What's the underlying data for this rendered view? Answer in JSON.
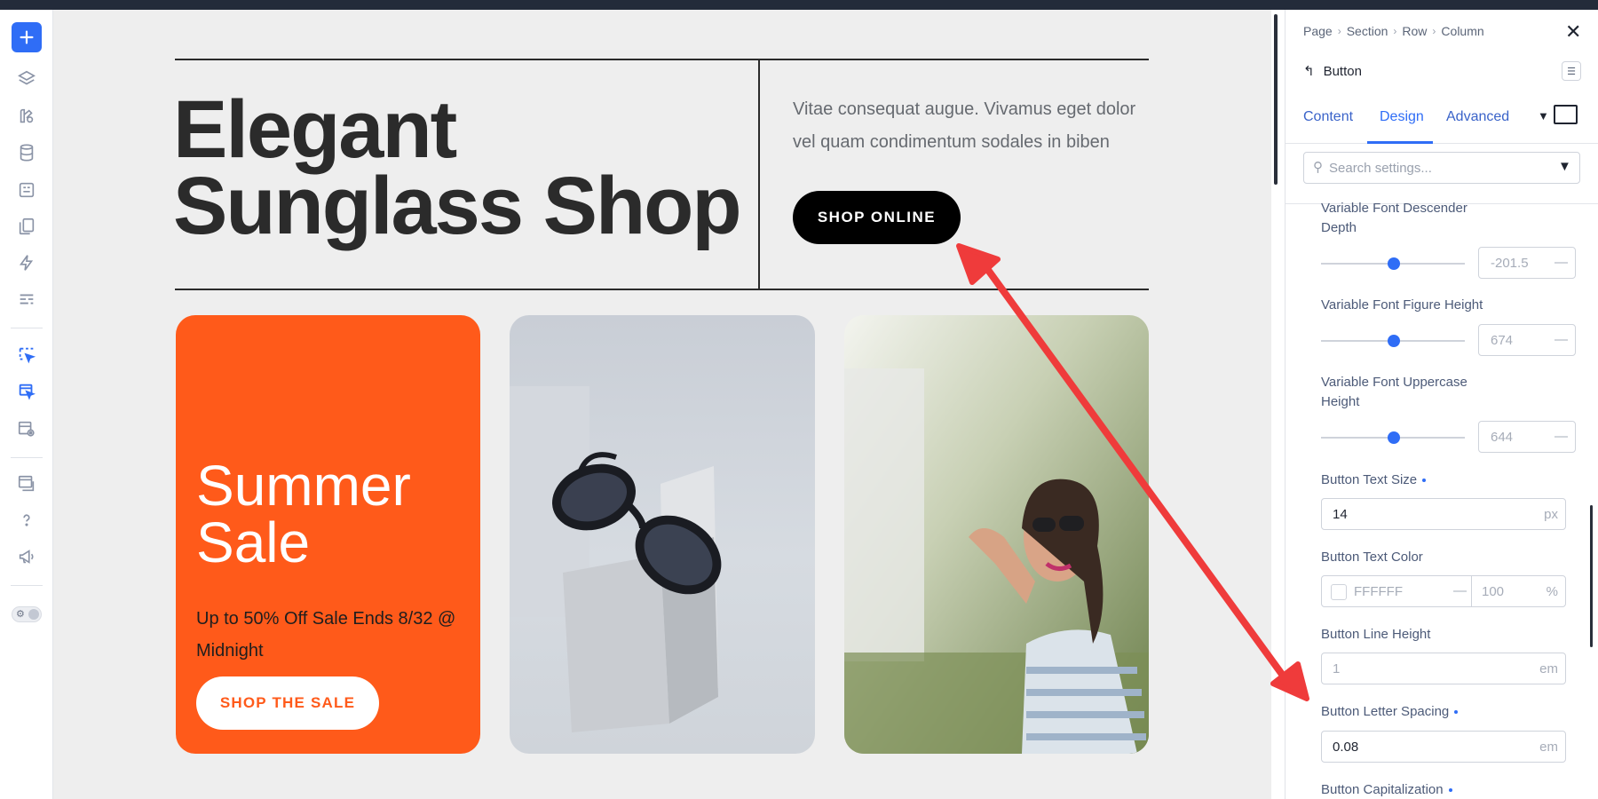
{
  "canvas": {
    "hero": {
      "title_line1": "Elegant",
      "title_line2": "Sunglass Shop",
      "paragraph": "Vitae consequat augue. Vivamus eget dolor vel quam condimentum sodales in biben",
      "cta_label": "SHOP ONLINE"
    },
    "sale_card": {
      "title_line1": "Summer",
      "title_line2": "Sale",
      "subtitle": "Up to 50% Off Sale Ends 8/32 @ Midnight",
      "cta_label": "SHOP THE SALE"
    }
  },
  "sidebar": {
    "icons": [
      "add-icon",
      "layers-icon",
      "paint-icon",
      "database-icon",
      "form-icon",
      "pages-icon",
      "bolt-icon",
      "template-icon",
      "cursor-select-icon",
      "cursor-multi-icon",
      "preview-icon",
      "windows-icon",
      "help-icon",
      "megaphone-icon",
      "theme-toggle-icon"
    ]
  },
  "panel": {
    "breadcrumb": [
      "Page",
      "Section",
      "Row",
      "Column"
    ],
    "element_title": "Button",
    "tabs": [
      "Content",
      "Design",
      "Advanced"
    ],
    "active_tab": "Design",
    "search_placeholder": "Search settings...",
    "settings": {
      "descender": {
        "label_line1": "Variable Font Descender",
        "label_line2": "Depth",
        "value": "-201.5"
      },
      "figure_height": {
        "label": "Variable Font Figure Height",
        "value": "674"
      },
      "uppercase": {
        "label_line1": "Variable Font Uppercase",
        "label_line2": "Height",
        "value": "644"
      },
      "text_size": {
        "label": "Button Text Size",
        "value": "14",
        "unit": "px"
      },
      "text_color": {
        "label": "Button Text Color",
        "hex": "FFFFFF",
        "opacity": "100",
        "unit": "%"
      },
      "line_height": {
        "label": "Button Line Height",
        "value": "1",
        "unit": "em"
      },
      "letter_spacing": {
        "label": "Button Letter Spacing",
        "value": "0.08",
        "unit": "em"
      },
      "capitalization": {
        "label": "Button Capitalization"
      }
    }
  },
  "colors": {
    "accent": "#2f6df6",
    "sale_orange": "#ff5a1a",
    "annotation_red": "#ef3b3b"
  }
}
